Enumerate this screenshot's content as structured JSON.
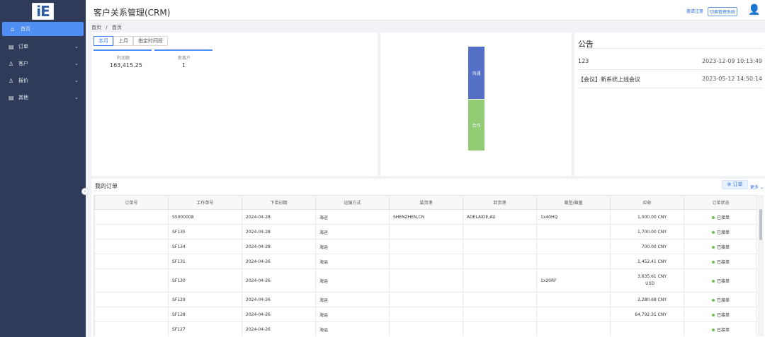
{
  "app": {
    "logo_text": "iE",
    "title": "客户关系管理(CRM)",
    "top_links": [
      "邀请注册",
      "切换管理系统"
    ]
  },
  "sidebar": {
    "items": [
      {
        "label": "首页",
        "icon": "home-icon",
        "active": true
      },
      {
        "label": "订单",
        "icon": "order-icon",
        "expandable": true
      },
      {
        "label": "客户",
        "icon": "customer-icon",
        "expandable": true
      },
      {
        "label": "报价",
        "icon": "quote-icon",
        "expandable": true
      },
      {
        "label": "其他",
        "icon": "other-icon",
        "expandable": true
      }
    ]
  },
  "breadcrumb": {
    "root": "首页",
    "separator": "/",
    "current": "首页"
  },
  "summary": {
    "tabs": [
      "本月",
      "上月",
      "指定时间段"
    ],
    "stats": [
      {
        "label": "利润额",
        "value": "163,415.25"
      },
      {
        "label": "新客户",
        "value": "1"
      }
    ]
  },
  "chart_data": {
    "type": "bar",
    "categories": [
      ""
    ],
    "series": [
      {
        "name": "沟通",
        "values": [
          1
        ]
      },
      {
        "name": "合作",
        "values": [
          1
        ]
      }
    ],
    "title": "",
    "xlabel": "",
    "ylabel": "",
    "grid": false,
    "colors": [
      "#5470c6",
      "#91cc75"
    ]
  },
  "announcements": {
    "title": "公告",
    "items": [
      {
        "text": "123",
        "time": "2023-12-09 10:13:49"
      },
      {
        "text": "【会议】新系统上线会议",
        "time": "2023-05-12 14:50:14"
      }
    ]
  },
  "orders": {
    "title": "我的订单",
    "add_label": "订单",
    "more_label": "更多",
    "columns": [
      "订单号",
      "工作单号",
      "下单日期",
      "运输方式",
      "装货港",
      "卸货港",
      "箱型/箱量",
      "应收",
      "订单状态"
    ],
    "rows": [
      {
        "order_no": "",
        "work_no": "SS000008",
        "date": "2024-04-28",
        "transport": "海运",
        "pol": "SHENZHEN,CN",
        "pod": "ADELAIDE,AU",
        "container": "1x40HQ",
        "receivable": "1,000.00 CNY",
        "status": "已接单"
      },
      {
        "order_no": "",
        "work_no": "SF135",
        "date": "2024-04-28",
        "transport": "海运",
        "pol": "",
        "pod": "",
        "container": "",
        "receivable": "1,700.00 CNY",
        "status": "已接单"
      },
      {
        "order_no": "",
        "work_no": "SF134",
        "date": "2024-04-28",
        "transport": "海运",
        "pol": "",
        "pod": "",
        "container": "",
        "receivable": "700.00 CNY",
        "status": "已接单"
      },
      {
        "order_no": "",
        "work_no": "SF131",
        "date": "2024-04-26",
        "transport": "海运",
        "pol": "",
        "pod": "",
        "container": "",
        "receivable": "1,452.41 CNY",
        "status": "已接单"
      },
      {
        "order_no": "",
        "work_no": "SF130",
        "date": "2024-04-26",
        "transport": "海运",
        "pol": "",
        "pod": "",
        "container": "1x20RF",
        "receivable": "3,635.61 CNY",
        "receivable_extra": "USD",
        "status": "已接单"
      },
      {
        "order_no": "",
        "work_no": "SF129",
        "date": "2024-04-26",
        "transport": "海运",
        "pol": "",
        "pod": "",
        "container": "",
        "receivable": "2,280.68 CNY",
        "status": "已接单"
      },
      {
        "order_no": "",
        "work_no": "SF128",
        "date": "2024-04-26",
        "transport": "海运",
        "pol": "",
        "pod": "",
        "container": "",
        "receivable": "64,792.31 CNY",
        "status": "已接单"
      },
      {
        "order_no": "",
        "work_no": "SF127",
        "date": "2024-04-26",
        "transport": "海运",
        "pol": "",
        "pod": "",
        "container": "",
        "receivable": "",
        "status": "已接单"
      }
    ]
  }
}
